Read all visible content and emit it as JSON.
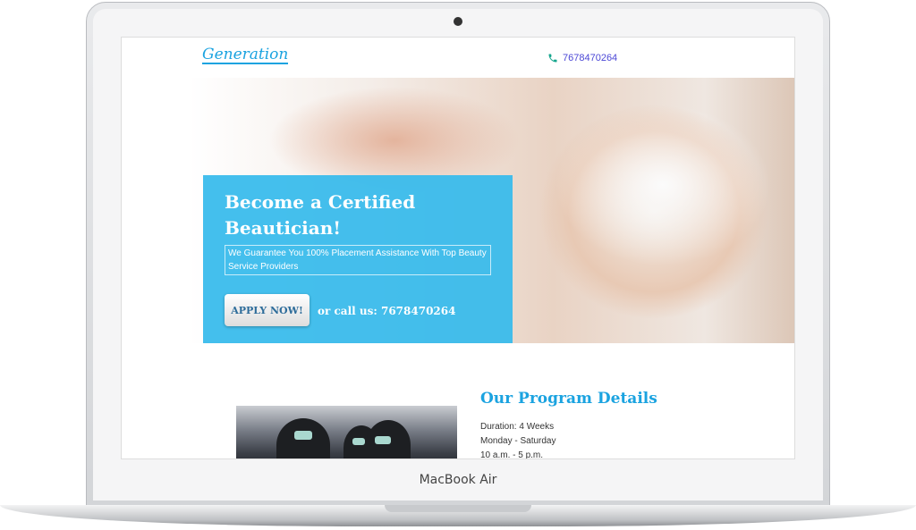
{
  "device": {
    "label": "MacBook Air"
  },
  "header": {
    "logo": "Generation",
    "phone": "7678470264"
  },
  "hero": {
    "title": "Become a Certified Beautician!",
    "subtitle": "We Guarantee You 100% Placement Assistance With Top Beauty Service Providers",
    "apply_label": "APPLY NOW!",
    "call_text": "or  call us: 7678470264"
  },
  "program": {
    "title": "Our Program Details",
    "lines": [
      "Duration: 4 Weeks",
      "Monday - Saturday",
      "10 a.m. - 5 p.m."
    ]
  },
  "colors": {
    "accent": "#1ba3e0",
    "card": "#36baec",
    "phone": "#4b47d6"
  }
}
